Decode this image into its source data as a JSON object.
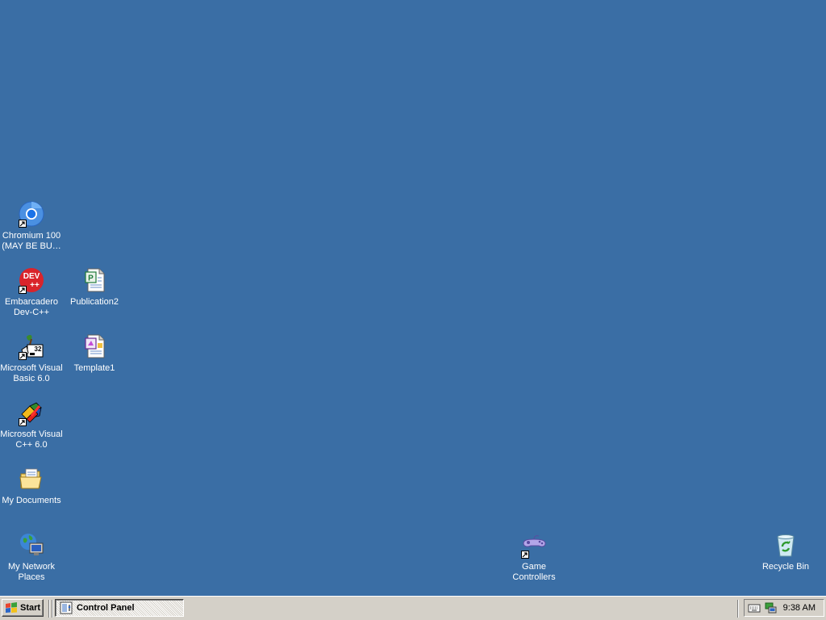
{
  "desktop": {
    "icons": [
      {
        "id": "chromium",
        "label": "Chromium 100 (MAY BE BU…",
        "icon": "chromium-icon",
        "shortcut": true
      },
      {
        "id": "devcpp",
        "label": "Embarcadero Dev-C++",
        "icon": "devcpp-icon",
        "icon_text": "DEV\n++",
        "shortcut": true
      },
      {
        "id": "publication2",
        "label": "Publication2",
        "icon": "publisher-document-icon",
        "shortcut": false
      },
      {
        "id": "vb6",
        "label": "Microsoft Visual Basic 6.0",
        "icon": "visual-basic-icon",
        "shortcut": true
      },
      {
        "id": "template1",
        "label": "Template1",
        "icon": "template-document-icon",
        "shortcut": false
      },
      {
        "id": "vcpp6",
        "label": "Microsoft Visual C++ 6.0",
        "icon": "visual-cpp-icon",
        "shortcut": true
      },
      {
        "id": "mydocuments",
        "label": "My Documents",
        "icon": "my-documents-folder-icon",
        "shortcut": false
      },
      {
        "id": "mynetwork",
        "label": "My Network Places",
        "icon": "network-places-icon",
        "shortcut": false
      },
      {
        "id": "gamecontrollers",
        "label": "Game Controllers",
        "icon": "game-controller-icon",
        "shortcut": true
      },
      {
        "id": "recyclebin",
        "label": "Recycle Bin",
        "icon": "recycle-bin-icon",
        "shortcut": false
      }
    ],
    "background_color": "#3a6ea5"
  },
  "taskbar": {
    "start_label": "Start",
    "tasks": [
      {
        "label": "Control Panel",
        "icon": "control-panel-icon",
        "active": true
      }
    ],
    "tray": {
      "icons": [
        "keyboard-icon",
        "network-connection-icon"
      ],
      "clock": "9:38 AM"
    }
  }
}
